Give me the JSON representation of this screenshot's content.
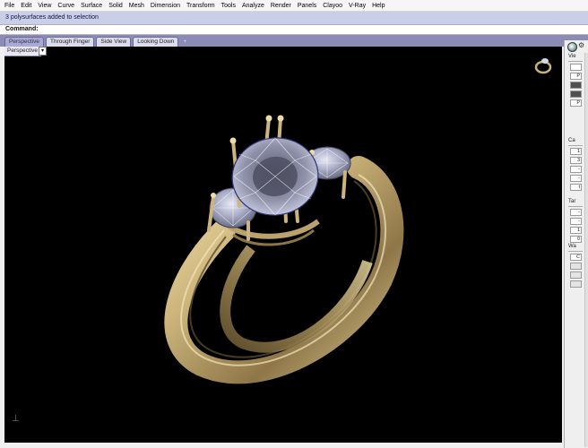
{
  "menu": [
    "File",
    "Edit",
    "View",
    "Curve",
    "Surface",
    "Solid",
    "Mesh",
    "Dimension",
    "Transform",
    "Tools",
    "Analyze",
    "Render",
    "Panels",
    "Clayoo",
    "V-Ray",
    "Help"
  ],
  "history": {
    "message": "3 polysurfaces added to selection"
  },
  "command": {
    "prompt": "Command:"
  },
  "viewport_tabs": [
    {
      "label": "Perspective",
      "active": true
    },
    {
      "label": "Through Finger",
      "active": false
    },
    {
      "label": "Side View",
      "active": false
    },
    {
      "label": "Looking Down",
      "active": false
    }
  ],
  "add_tab": "+",
  "viewport": {
    "label": "Perspective",
    "dropdown_glyph": "▾",
    "axis_glyph": "⊥"
  },
  "panel": {
    "gear_glyph": "⚙",
    "sections": [
      {
        "title": "Vie",
        "items": [
          "",
          "P",
          "",
          "",
          "P"
        ]
      },
      {
        "title": "Ca",
        "items": [
          "1",
          "3",
          "-",
          "-",
          "t"
        ]
      },
      {
        "title": "Tar",
        "items": [
          "-",
          "-",
          "1",
          "0"
        ]
      },
      {
        "title": "Wa",
        "items": [
          "C",
          "",
          "",
          ""
        ]
      }
    ]
  },
  "colors": {
    "history_bg": "#c9cfe6",
    "tabrow_bg": "#8b8bb5",
    "viewport_bg": "#000000",
    "gold": "#c9b27a",
    "gem": "#b9bcd2"
  }
}
